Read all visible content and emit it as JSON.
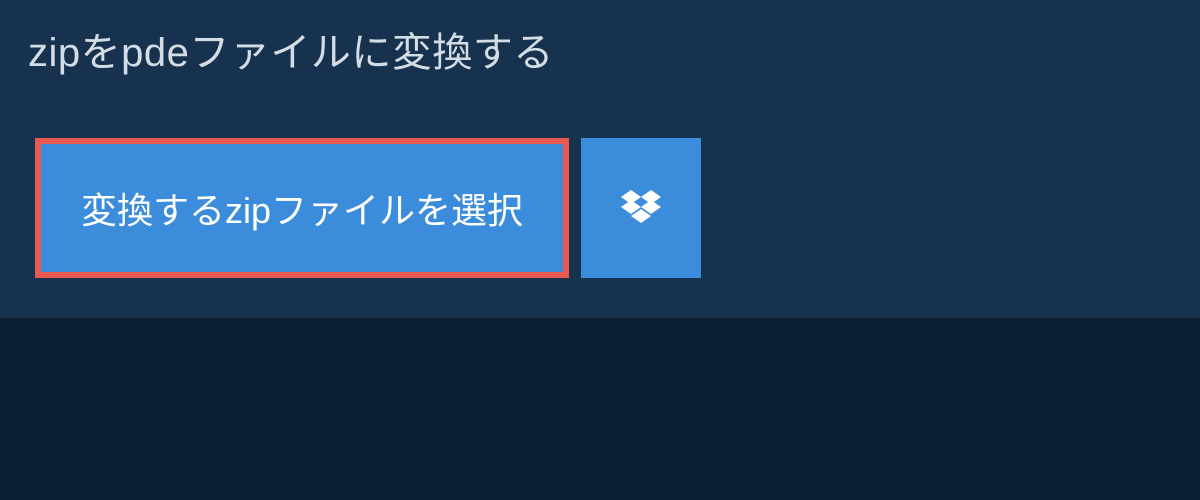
{
  "header": {
    "title": "zipをpdeファイルに変換する"
  },
  "buttons": {
    "select_file_label": "変換するzipファイルを選択"
  }
}
